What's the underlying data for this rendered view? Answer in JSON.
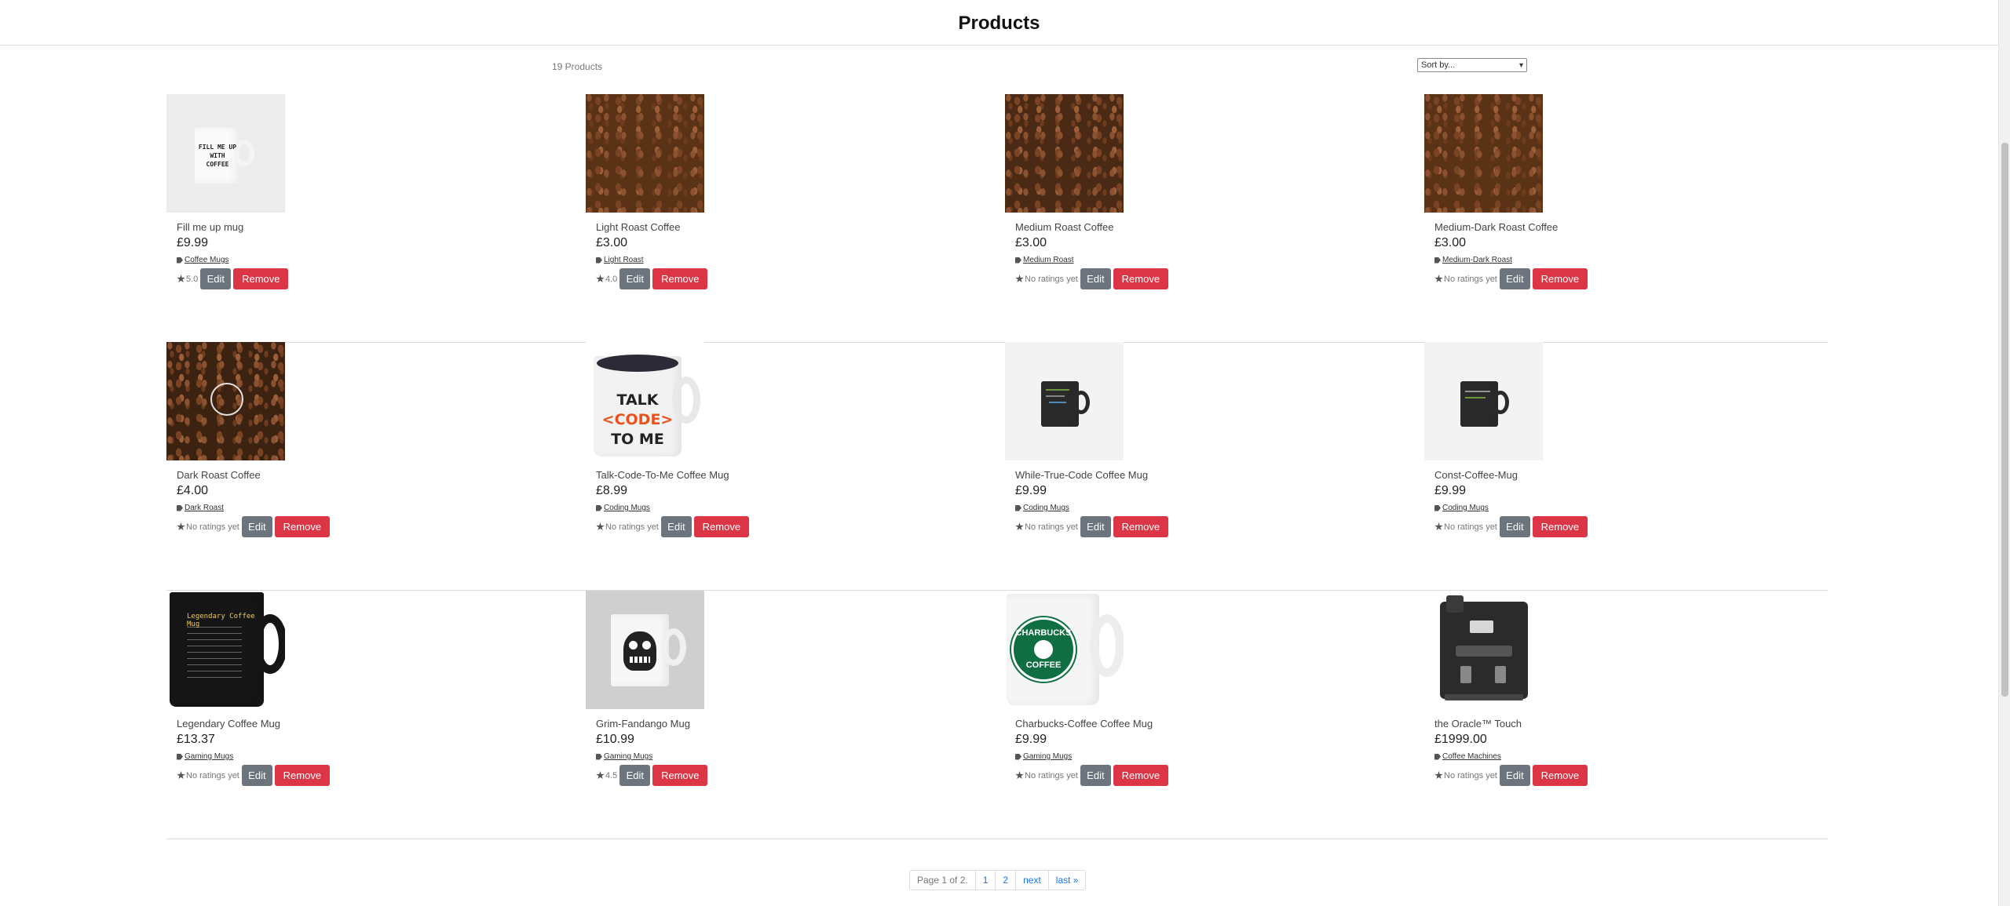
{
  "page": {
    "title": "Products"
  },
  "listing": {
    "count_label": "19 Products",
    "sort_label": "Sort by..."
  },
  "rows": [
    [
      {
        "name": "Fill me up mug",
        "price": "£9.99",
        "category": "Coffee Mugs",
        "rating": "5.0",
        "mug_text": "FILL ME UP WITH COFFEE"
      },
      {
        "name": "Light Roast Coffee",
        "price": "£3.00",
        "category": "Light Roast",
        "rating": "4.0"
      },
      {
        "name": "Medium Roast Coffee",
        "price": "£3.00",
        "category": "Medium Roast",
        "rating": "No ratings yet"
      },
      {
        "name": "Medium-Dark Roast Coffee",
        "price": "£3.00",
        "category": "Medium-Dark Roast",
        "rating": "No ratings yet"
      }
    ],
    [
      {
        "name": "Dark Roast Coffee",
        "price": "£4.00",
        "category": "Dark Roast",
        "rating": "No ratings yet"
      },
      {
        "name": "Talk-Code-To-Me Coffee Mug",
        "price": "£8.99",
        "category": "Coding Mugs",
        "rating": "No ratings yet",
        "mug_text": [
          "TALK",
          "<CODE>",
          "TO ME"
        ]
      },
      {
        "name": "While-True-Code Coffee Mug",
        "price": "£9.99",
        "category": "Coding Mugs",
        "rating": "No ratings yet"
      },
      {
        "name": "Const-Coffee-Mug",
        "price": "£9.99",
        "category": "Coding Mugs",
        "rating": "No ratings yet"
      }
    ],
    [
      {
        "name": "Legendary Coffee Mug",
        "price": "£13.37",
        "category": "Gaming Mugs",
        "rating": "No ratings yet",
        "mug_text": "Legendary Coffee Mug"
      },
      {
        "name": "Grim-Fandango Mug",
        "price": "£10.99",
        "category": "Gaming Mugs",
        "rating": "4.5"
      },
      {
        "name": "Charbucks-Coffee Coffee Mug",
        "price": "£9.99",
        "category": "Gaming Mugs",
        "rating": "No ratings yet",
        "mug_text": [
          "CHARBUCKS",
          "COFFEE"
        ]
      },
      {
        "name": "the Oracle™ Touch",
        "price": "£1999.00",
        "category": "Coffee Machines",
        "rating": "No ratings yet"
      }
    ]
  ],
  "buttons": {
    "edit": "Edit",
    "remove": "Remove"
  },
  "pagination": {
    "status": "Page 1 of 2.",
    "page1": "1",
    "page2": "2",
    "next": "next",
    "last": "last »"
  },
  "colors": {
    "edit": "#6c757d",
    "remove": "#dc3545",
    "link": "#1a73e8"
  }
}
